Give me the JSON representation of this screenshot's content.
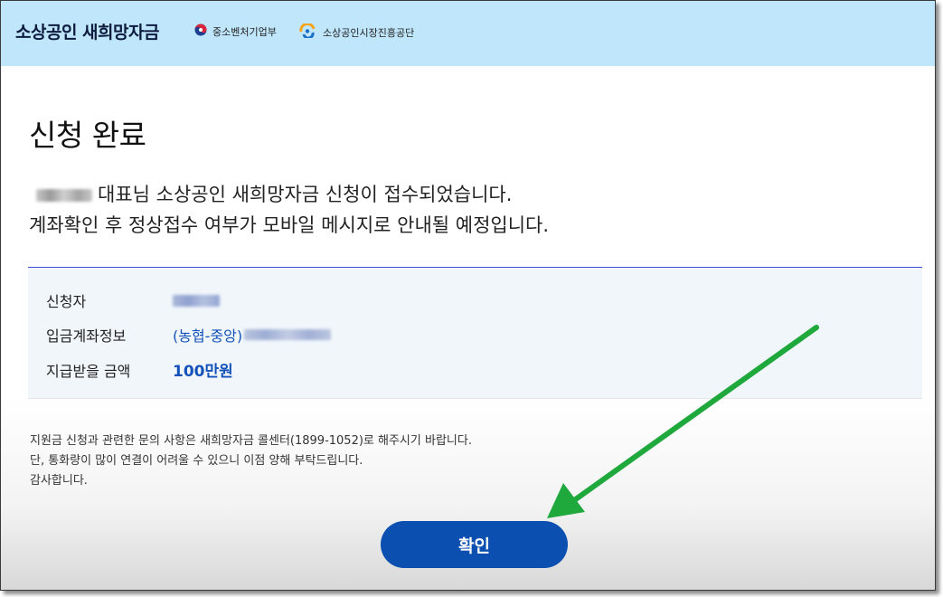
{
  "header": {
    "brand": "소상공인 새희망자금",
    "ministry": "중소벤처기업부",
    "agency": "소상공인시장진흥공단"
  },
  "main": {
    "title": "신청 완료",
    "message_line1_suffix": "대표님 소상공인 새희망자금 신청이 접수되었습니다.",
    "message_line2": "계좌확인 후 정상접수 여부가 모바일 메시지로 안내될 예정입니다."
  },
  "info": {
    "applicant_label": "신청자",
    "account_label": "입금계좌정보",
    "account_bank": "(농협-중앙)",
    "amount_label": "지급받을 금액",
    "amount_value": "100만원"
  },
  "notice": {
    "line1": "지원금 신청과 관련한 문의 사항은 새희망자금 콜센터(1899-1052)로 해주시기 바랍니다.",
    "line2": "단, 통화량이 많이 연결이 어려울 수 있으니 이점 양해 부탁드립니다.",
    "line3": "감사합니다."
  },
  "actions": {
    "confirm_label": "확인"
  },
  "colors": {
    "header_bg": "#bfe6fb",
    "accent_blue": "#1352b8",
    "button_bg": "#0b4fb0",
    "annotation_arrow": "#1fa83c"
  },
  "icons": {
    "ministry_emblem": "taegeuk-icon",
    "agency_emblem": "agency-logo-icon",
    "annotation": "green-arrow-icon"
  }
}
